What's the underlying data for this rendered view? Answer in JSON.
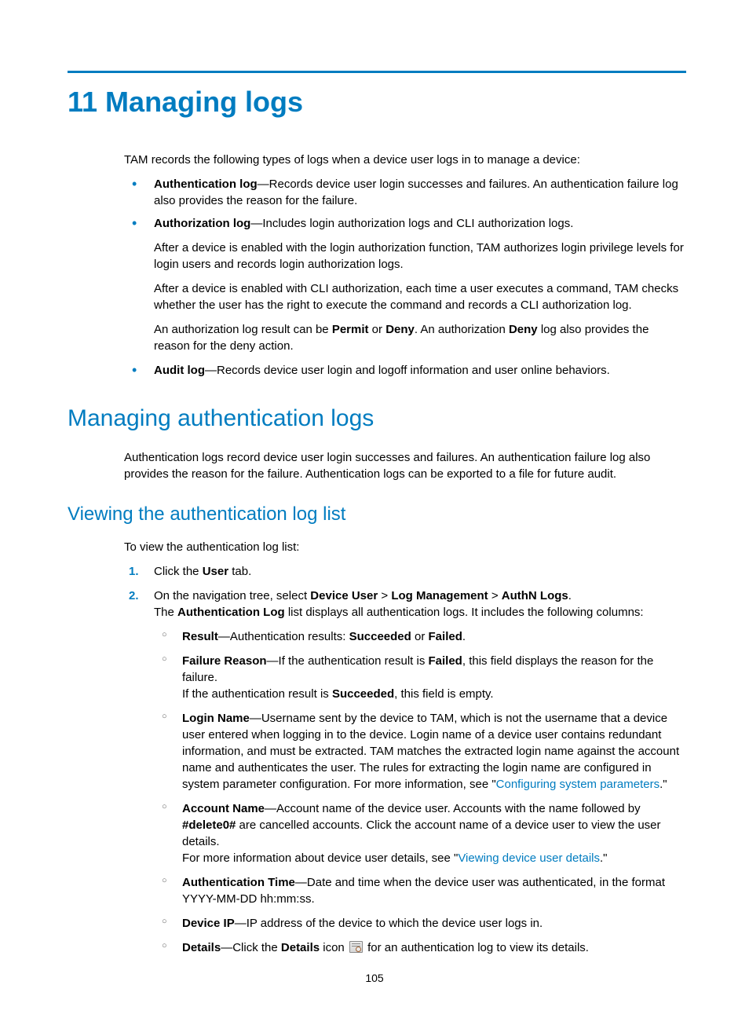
{
  "h1": "11 Managing logs",
  "intro": "TAM records the following types of logs when a device user logs in to manage a device:",
  "logTypes": {
    "auth_label": "Authentication log",
    "auth_body": "—Records device user login successes and failures. An authentication failure log also provides the reason for the failure.",
    "authz_label": "Authorization log",
    "authz_body": "—Includes login authorization logs and CLI authorization logs.",
    "authz_p1": "After a device is enabled with the login authorization function, TAM authorizes login privilege levels for login users and records login authorization logs.",
    "authz_p2": "After a device is enabled with CLI authorization, each time a user executes a command, TAM checks whether the user has the right to execute the command and records a CLI authorization log.",
    "authz_p3_a": "An authorization log result can be ",
    "authz_p3_permit": "Permit",
    "authz_p3_b": " or ",
    "authz_p3_deny": "Deny",
    "authz_p3_c": ". An authorization ",
    "authz_p3_deny2": "Deny",
    "authz_p3_d": " log also provides the reason for the deny action.",
    "audit_label": "Audit log",
    "audit_body": "—Records device user login and logoff information and user online behaviors."
  },
  "h2": "Managing authentication logs",
  "authIntro": "Authentication logs record device user login successes and failures. An authentication failure log also provides the reason for the failure. Authentication logs can be exported to a file for future audit.",
  "h3": "Viewing the authentication log list",
  "viewIntro": "To view the authentication log list:",
  "steps": {
    "s1_a": "Click the ",
    "s1_user": "User",
    "s1_b": " tab.",
    "s2_a": "On the navigation tree, select ",
    "s2_deviceUser": "Device User",
    "s2_gt1": " > ",
    "s2_logMgmt": "Log Management",
    "s2_gt2": " > ",
    "s2_authn": "AuthN Logs",
    "s2_b": ".",
    "s2_p_a": "The ",
    "s2_p_al": "Authentication Log",
    "s2_p_b": " list displays all authentication logs. It includes the following columns:"
  },
  "cols": {
    "result_label": "Result",
    "result_a": "—Authentication results: ",
    "result_succ": "Succeeded",
    "result_b": " or ",
    "result_fail": "Failed",
    "result_c": ".",
    "fr_label": "Failure Reason",
    "fr_a": "—If the authentication result is ",
    "fr_failed": "Failed",
    "fr_b": ", this field displays the reason for the failure.",
    "fr_p_a": "If the authentication result is ",
    "fr_p_succ": "Succeeded",
    "fr_p_b": ", this field is empty.",
    "ln_label": "Login Name",
    "ln_body": "—Username sent by the device to TAM, which is not the username that a device user entered when logging in to the device. Login name of a device user contains redundant information, and must be extracted. TAM matches the extracted login name against the account name and authenticates the user. The rules for extracting the login name are configured in system parameter configuration. For more information, see \"",
    "ln_link": "Configuring system parameters",
    "ln_after": ".\"",
    "an_label": "Account Name",
    "an_a": "—Account name of the device user. Accounts with the name followed by ",
    "an_del": "#delete0#",
    "an_b": " are cancelled accounts. Click the account name of a device user to view the user details.",
    "an_p_a": "For more information about device user details, see \"",
    "an_link": "Viewing device user details",
    "an_p_b": ".\"",
    "at_label": "Authentication Time",
    "at_body": "—Date and time when the device user was authenticated, in the format YYYY-MM-DD hh:mm:ss.",
    "dip_label": "Device IP",
    "dip_body": "—IP address of the device to which the device user logs in.",
    "det_label": "Details",
    "det_a": "—Click the ",
    "det_details": "Details",
    "det_b": " icon ",
    "det_c": " for an authentication log to view its details."
  },
  "pageNum": "105"
}
